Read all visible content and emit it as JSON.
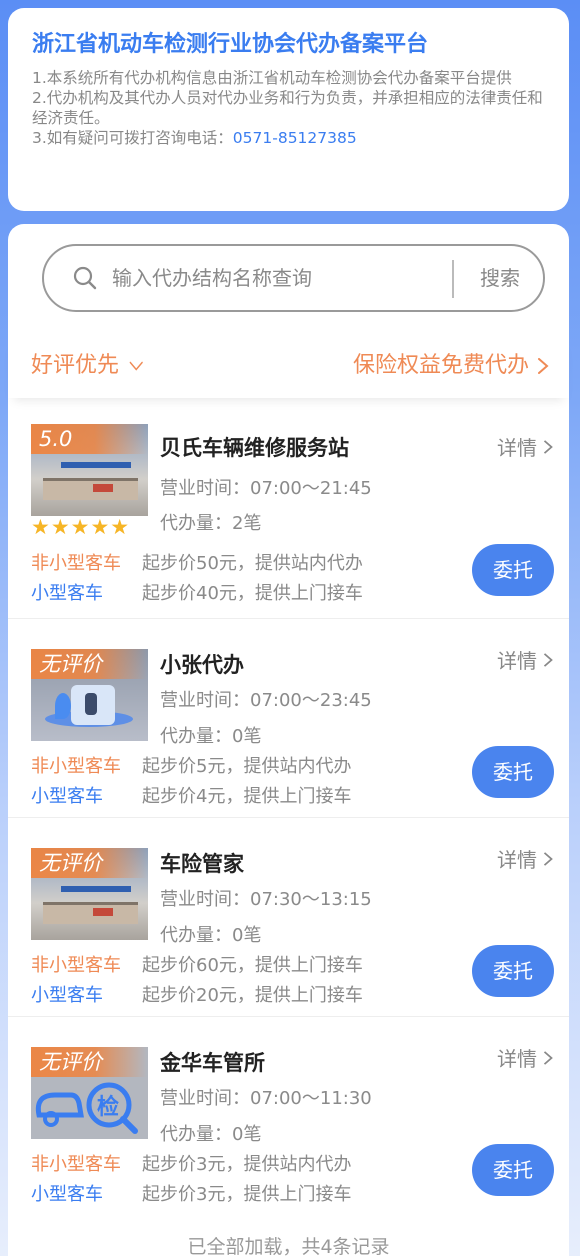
{
  "header": {
    "title": "浙江省机动车检测行业协会代办备案平台",
    "notice_1": "1.本系统所有代办机构信息由浙江省机动车检测协会代办备案平台提供",
    "notice_2": "2.代办机构及其代办人员对代办业务和行为负责，并承担相应的法律责任和经济责任。",
    "notice_3_prefix": "3.如有疑问可拨打咨询电话：",
    "phone": "0571-85127385"
  },
  "search": {
    "placeholder": "输入代办结构名称查询",
    "button_label": "搜索"
  },
  "filters": {
    "sort_label": "好评优先",
    "insurance_label": "保险权益免费代办"
  },
  "colors": {
    "accent_blue": "#3a7df0",
    "accent_orange": "#ef8a55",
    "star": "#f6b526"
  },
  "items": [
    {
      "badge": "5.0",
      "stars": "★★★★★",
      "name": "贝氏车辆维修服务站",
      "detail_label": "详情",
      "hours_label": "营业时间：",
      "hours": "07:00～21:45",
      "count_label": "代办量：",
      "count": "2笔",
      "type_1": "非小型客车",
      "price_1": "起步价50元，提供站内代办",
      "type_2": "小型客车",
      "price_2": "起步价40元，提供上门接车",
      "button_label": "委托"
    },
    {
      "badge": "无评价",
      "name": "小张代办",
      "detail_label": "详情",
      "hours_label": "营业时间：",
      "hours": "07:00～23:45",
      "count_label": "代办量：",
      "count": "0笔",
      "type_1": "非小型客车",
      "price_1": "起步价5元，提供站内代办",
      "type_2": "小型客车",
      "price_2": "起步价4元，提供上门接车",
      "button_label": "委托"
    },
    {
      "badge": "无评价",
      "name": "车险管家",
      "detail_label": "详情",
      "hours_label": "营业时间：",
      "hours": "07:30～13:15",
      "count_label": "代办量：",
      "count": "0笔",
      "type_1": "非小型客车",
      "price_1": "起步价60元，提供上门接车",
      "type_2": "小型客车",
      "price_2": "起步价20元，提供上门接车",
      "button_label": "委托"
    },
    {
      "badge": "无评价",
      "logo_text": "检",
      "name": "金华车管所",
      "detail_label": "详情",
      "hours_label": "营业时间：",
      "hours": "07:00～11:30",
      "count_label": "代办量：",
      "count": "0笔",
      "type_1": "非小型客车",
      "price_1": "起步价3元，提供站内代办",
      "type_2": "小型客车",
      "price_2": "起步价3元，提供上门接车",
      "button_label": "委托"
    }
  ],
  "footer": {
    "text": "已全部加载，共4条记录"
  }
}
